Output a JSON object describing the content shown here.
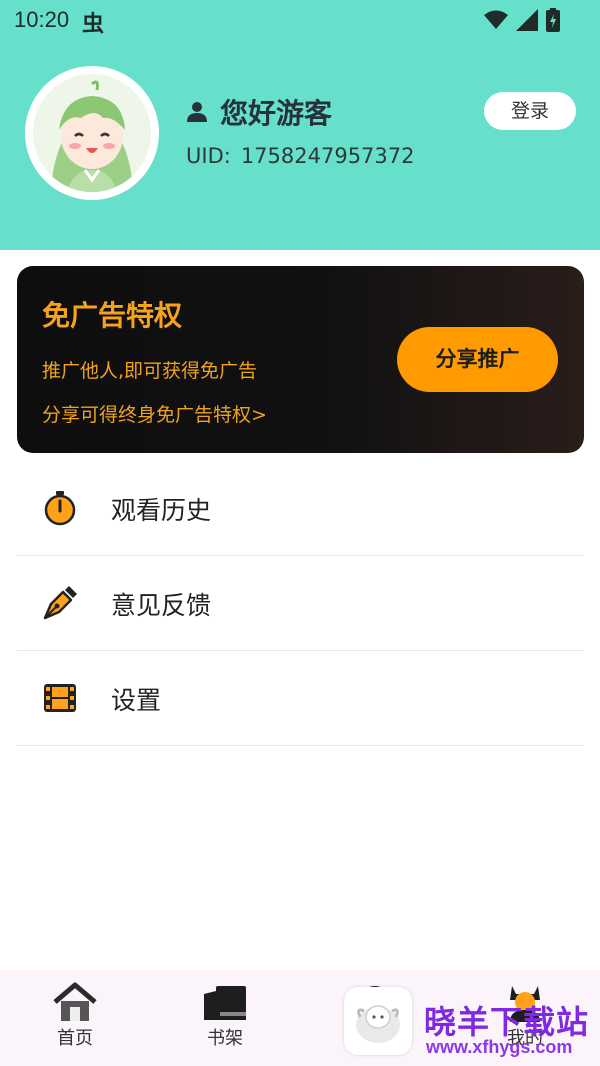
{
  "status_bar": {
    "time": "10:20",
    "bug_glyph": "虫"
  },
  "profile": {
    "greeting": "您好游客",
    "uid_label": "UID:",
    "uid_value": "1758247957372",
    "login_label": "登录"
  },
  "promo": {
    "title": "免广告特权",
    "line1": "推广他人,即可获得免广告",
    "line2": "分享可得终身免广告特权>",
    "share_label": "分享推广"
  },
  "menu": [
    {
      "label": "观看历史",
      "icon": "stopwatch-icon"
    },
    {
      "label": "意见反馈",
      "icon": "pen-nib-icon"
    },
    {
      "label": "设置",
      "icon": "film-icon"
    }
  ],
  "tabs": [
    {
      "label": "首页",
      "icon": "home-icon"
    },
    {
      "label": "书架",
      "icon": "bookshelf-icon"
    },
    {
      "label": "",
      "icon": "video-icon"
    },
    {
      "label": "我的",
      "icon": "profile-icon"
    }
  ],
  "watermark": {
    "title": "晓羊下载站",
    "url": "www.xfhygs.com"
  },
  "colors": {
    "header_bg": "#66e0cb",
    "accent_orange": "#ff9a00",
    "promo_text": "#f0a21f",
    "watermark_purple": "#7f2ae0"
  }
}
